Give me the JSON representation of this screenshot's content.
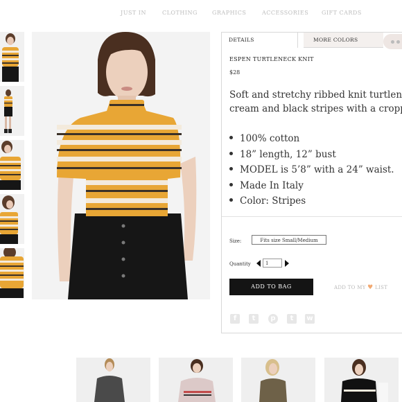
{
  "nav": {
    "items": [
      "JUST IN",
      "CLOTHING",
      "GRAPHICS",
      "ACCESSORIES",
      "GIFT CARDS"
    ]
  },
  "product": {
    "tabs": {
      "details": "DETAILS",
      "more_colors": "MORE COLORS"
    },
    "title": "ESPEN TURTLENECK KNIT",
    "price": "$28",
    "description_lines": [
      "Soft and stretchy ribbed knit turtleneck",
      "cream and black stripes with a cropped"
    ],
    "bullets": [
      "100% cotton",
      "18” length, 12” bust",
      "MODEL is 5’8” with a 24” waist.",
      "Made In Italy",
      "Color: Stripes"
    ],
    "size": {
      "label": "Size:",
      "value": "Fits size Small/Medium"
    },
    "quantity": {
      "label": "Quantity",
      "value": "1"
    },
    "add_to_bag": "ADD TO BAG",
    "wishlist": {
      "prefix": "ADD TO MY",
      "suffix": "LIST"
    },
    "social_icons": [
      "facebook-icon",
      "twitter-icon",
      "pinterest-icon",
      "tumblr-icon",
      "wanelo-icon"
    ]
  },
  "colors": {
    "stripe_mustard": "#e8a635",
    "stripe_cream": "#f3eadc",
    "stripe_dark": "#3b3128",
    "skirt": "#161616",
    "button": "#141414",
    "heart": "#f1a972"
  }
}
